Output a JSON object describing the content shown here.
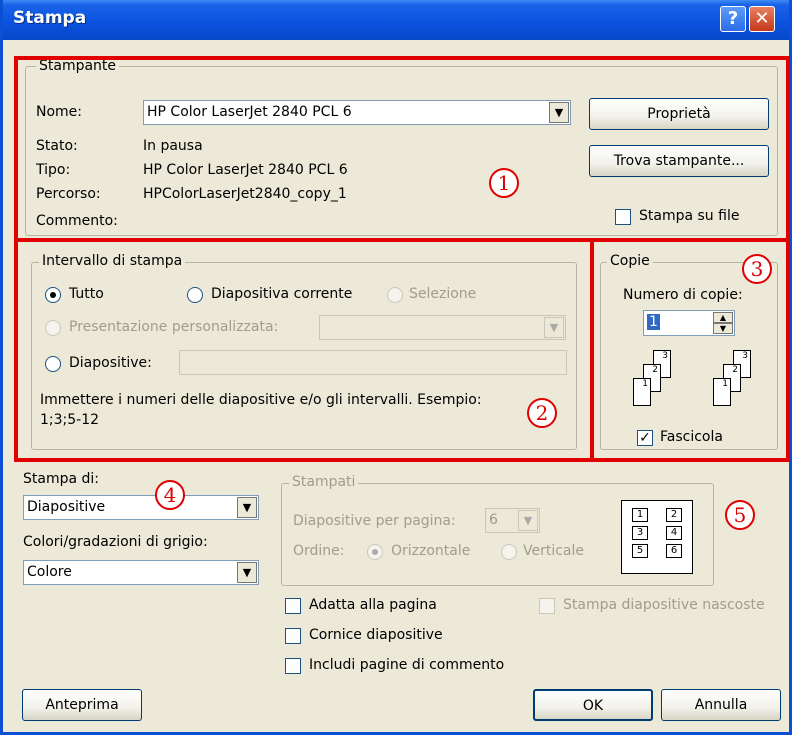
{
  "window": {
    "title": "Stampa",
    "help_glyph": "?",
    "close_glyph": "✕"
  },
  "printer": {
    "group_label": "Stampante",
    "name_label": "Nome:",
    "name_value": "HP Color LaserJet 2840 PCL 6",
    "status_label": "Stato:",
    "status_value": "In pausa",
    "type_label": "Tipo:",
    "type_value": "HP Color LaserJet 2840 PCL 6",
    "path_label": "Percorso:",
    "path_value": "HPColorLaserJet2840_copy_1",
    "comment_label": "Commento:",
    "properties_button": "Proprietà",
    "find_button": "Trova stampante...",
    "print_to_file_label": "Stampa su file"
  },
  "range": {
    "group_label": "Intervallo di stampa",
    "all_label": "Tutto",
    "current_label": "Diapositiva corrente",
    "selection_label": "Selezione",
    "custom_label": "Presentazione personalizzata:",
    "slides_label": "Diapositive:",
    "hint": "Immettere i numeri delle diapositive e/o gli intervalli. Esempio:",
    "hint_example": "1;3;5-12"
  },
  "copies": {
    "group_label": "Copie",
    "count_label": "Numero di copie:",
    "count_value": "1",
    "collate_label": "Fascicola"
  },
  "print_what": {
    "label": "Stampa di:",
    "value": "Diapositive"
  },
  "color": {
    "label": "Colori/gradazioni di grigio:",
    "value": "Colore"
  },
  "handouts": {
    "group_label": "Stampati",
    "per_page_label": "Diapositive per pagina:",
    "per_page_value": "6",
    "order_label": "Ordine:",
    "horizontal_label": "Orizzontale",
    "vertical_label": "Verticale",
    "preview_cells": [
      "1",
      "2",
      "3",
      "4",
      "5",
      "6"
    ]
  },
  "options": {
    "fit_label": "Adatta alla pagina",
    "frame_label": "Cornice diapositive",
    "comments_label": "Includi pagine di commento",
    "hidden_label": "Stampa diapositive nascoste"
  },
  "buttons": {
    "preview": "Anteprima",
    "ok": "OK",
    "cancel": "Annulla"
  },
  "callouts": [
    "1",
    "2",
    "3",
    "4",
    "5"
  ],
  "collate_pages": [
    "1",
    "2",
    "3"
  ],
  "colors": {
    "highlight": "#e00000",
    "titlebar": "#0a53de",
    "dialog_bg": "#ece9d8"
  }
}
